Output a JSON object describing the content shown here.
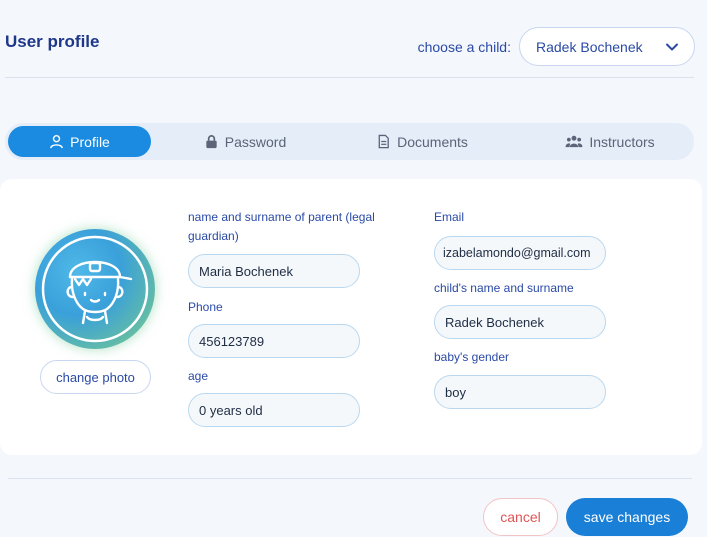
{
  "header": {
    "title": "User profile",
    "child_label": "choose a child:",
    "child_selected": "Radek Bochenek"
  },
  "tabs": [
    {
      "label": "Profile",
      "icon": "user-icon",
      "active": true
    },
    {
      "label": "Password",
      "icon": "lock-icon",
      "active": false
    },
    {
      "label": "Documents",
      "icon": "document-icon",
      "active": false
    },
    {
      "label": "Instructors",
      "icon": "users-icon",
      "active": false
    }
  ],
  "profile": {
    "change_photo": "change photo",
    "parent_label": "name and surname of parent (legal guardian)",
    "parent_value": "Maria Bochenek",
    "phone_label": "Phone",
    "phone_value": "456123789",
    "age_label": "age",
    "age_value": "0 years old",
    "email_label": "Email",
    "email_value": "izabelamondo@gmail.com",
    "child_name_label": "child's name and surname",
    "child_name_value": "Radek Bochenek",
    "gender_label": "baby's gender",
    "gender_value": "boy"
  },
  "actions": {
    "cancel": "cancel",
    "save": "save changes"
  },
  "colors": {
    "accent": "#1a8be0",
    "title": "#1f3788",
    "cancel": "#e05555"
  }
}
